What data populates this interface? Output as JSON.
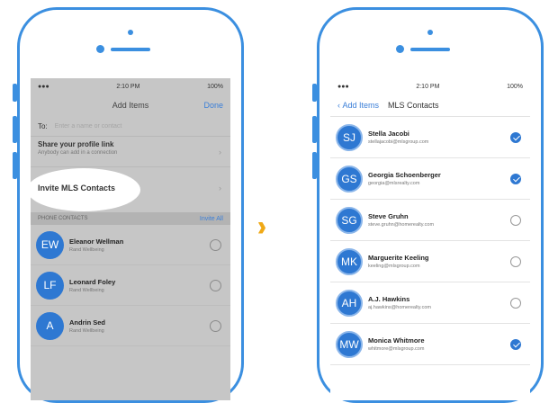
{
  "left_screen": {
    "status": {
      "time": "2:10 PM",
      "right": "100%"
    },
    "nav": {
      "title": "Add Items",
      "done": "Done"
    },
    "to": {
      "label": "To:",
      "placeholder": "Enter a name or contact"
    },
    "share_option": {
      "title": "Share your profile link",
      "subtitle": "Anybody can add in a connection"
    },
    "invite_label": "Invite MLS Contacts",
    "section": {
      "title": "PHONE CONTACTS",
      "action": "Invite All"
    },
    "contacts": [
      {
        "initials": "EW",
        "name": "Eleanor Wellman",
        "sub": "Rand Wellbeing"
      },
      {
        "initials": "LF",
        "name": "Leonard Foley",
        "sub": "Rand Wellbeing"
      },
      {
        "initials": "A",
        "name": "Andrin Sed",
        "sub": "Rand Wellbeing"
      }
    ]
  },
  "right_screen": {
    "status": {
      "time": "2:10 PM",
      "right": "100%"
    },
    "nav": {
      "back": "Add Items",
      "title": "MLS Contacts"
    },
    "contacts": [
      {
        "initials": "SJ",
        "name": "Stella Jacobi",
        "sub": "stellajacobi@mlsgroup.com",
        "checked": true
      },
      {
        "initials": "GS",
        "name": "Georgia Schoenberger",
        "sub": "georgia@mlsrealty.com",
        "checked": true
      },
      {
        "initials": "SG",
        "name": "Steve Gruhn",
        "sub": "steve.gruhn@homerealty.com",
        "checked": false
      },
      {
        "initials": "MK",
        "name": "Marguerite Keeling",
        "sub": "keeling@mlsgroup.com",
        "checked": false
      },
      {
        "initials": "AH",
        "name": "A.J. Hawkins",
        "sub": "aj.hawkins@homerealty.com",
        "checked": false
      },
      {
        "initials": "MW",
        "name": "Monica Whitmore",
        "sub": "whitmore@mlsgroup.com",
        "checked": true
      }
    ]
  },
  "arrows": "›››",
  "colors": {
    "accent": "#3b8fe0",
    "avatar": "#2e78d2",
    "arrows": "#f0a916"
  }
}
